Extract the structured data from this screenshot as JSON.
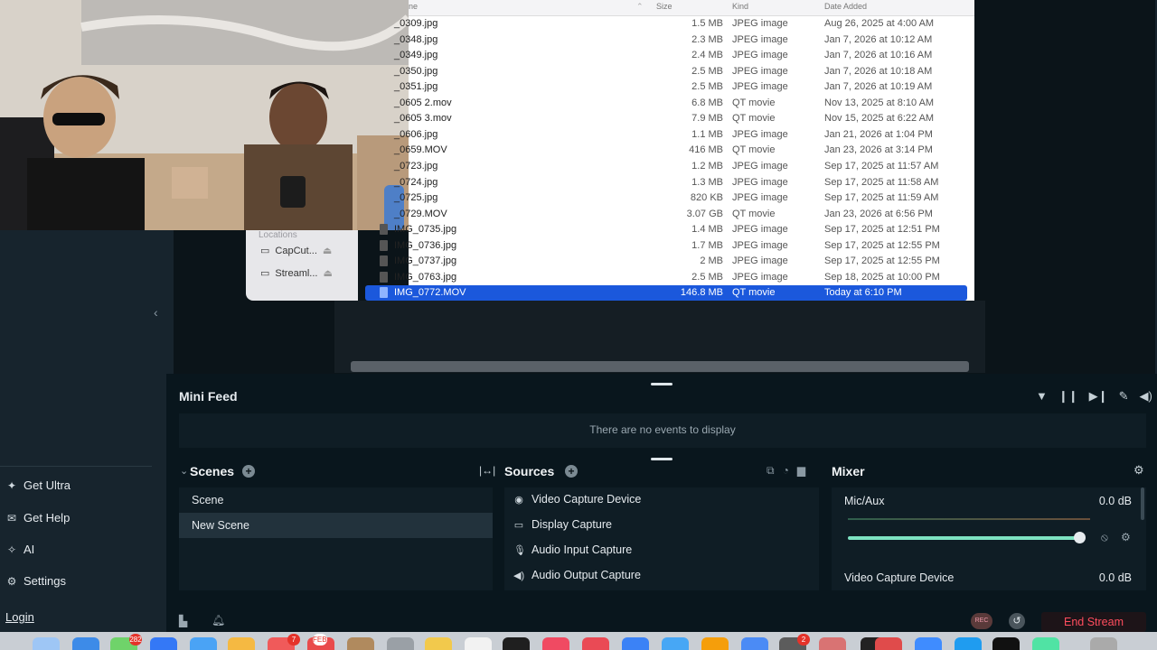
{
  "finder": {
    "columns": {
      "name": "ne",
      "size": "Size",
      "kind": "Kind",
      "date": "Date Added"
    },
    "sidebar": {
      "section": "Locations",
      "items": [
        {
          "label": "CapCut..."
        },
        {
          "label": "Streaml..."
        }
      ]
    },
    "files": [
      {
        "name": "_0309.jpg",
        "size": "1.5 MB",
        "kind": "JPEG image",
        "date": "Aug 26, 2025 at 4:00 AM"
      },
      {
        "name": "_0348.jpg",
        "size": "2.3 MB",
        "kind": "JPEG image",
        "date": "Jan 7, 2026 at 10:12 AM"
      },
      {
        "name": "_0349.jpg",
        "size": "2.4 MB",
        "kind": "JPEG image",
        "date": "Jan 7, 2026 at 10:16 AM"
      },
      {
        "name": "_0350.jpg",
        "size": "2.5 MB",
        "kind": "JPEG image",
        "date": "Jan 7, 2026 at 10:18 AM"
      },
      {
        "name": "_0351.jpg",
        "size": "2.5 MB",
        "kind": "JPEG image",
        "date": "Jan 7, 2026 at 10:19 AM"
      },
      {
        "name": "_0605 2.mov",
        "size": "6.8 MB",
        "kind": "QT movie",
        "date": "Nov 13, 2025 at 8:10 AM"
      },
      {
        "name": "_0605 3.mov",
        "size": "7.9 MB",
        "kind": "QT movie",
        "date": "Nov 15, 2025 at 6:22 AM"
      },
      {
        "name": "_0606.jpg",
        "size": "1.1 MB",
        "kind": "JPEG image",
        "date": "Jan 21, 2026 at 1:04 PM"
      },
      {
        "name": "_0659.MOV",
        "size": "416 MB",
        "kind": "QT movie",
        "date": "Jan 23, 2026 at 3:14 PM"
      },
      {
        "name": "_0723.jpg",
        "size": "1.2 MB",
        "kind": "JPEG image",
        "date": "Sep 17, 2025 at 11:57 AM"
      },
      {
        "name": "_0724.jpg",
        "size": "1.3 MB",
        "kind": "JPEG image",
        "date": "Sep 17, 2025 at 11:58 AM"
      },
      {
        "name": "_0725.jpg",
        "size": "820 KB",
        "kind": "JPEG image",
        "date": "Sep 17, 2025 at 11:59 AM"
      },
      {
        "name": "_0729.MOV",
        "size": "3.07 GB",
        "kind": "QT movie",
        "date": "Jan 23, 2026 at 6:56 PM"
      },
      {
        "name": "IMG_0735.jpg",
        "size": "1.4 MB",
        "kind": "JPEG image",
        "date": "Sep 17, 2025 at 12:51 PM"
      },
      {
        "name": "IMG_0736.jpg",
        "size": "1.7 MB",
        "kind": "JPEG image",
        "date": "Sep 17, 2025 at 12:55 PM"
      },
      {
        "name": "IMG_0737.jpg",
        "size": "2 MB",
        "kind": "JPEG image",
        "date": "Sep 17, 2025 at 12:55 PM"
      },
      {
        "name": "IMG_0763.jpg",
        "size": "2.5 MB",
        "kind": "JPEG image",
        "date": "Sep 18, 2025 at 10:00 PM"
      },
      {
        "name": "IMG_0772.MOV",
        "size": "146.8 MB",
        "kind": "QT movie",
        "date": "Today at 6:10 PM",
        "selected": true
      }
    ]
  },
  "sidebar": {
    "items": [
      {
        "label": "Get Ultra",
        "icon": "ultra-icon"
      },
      {
        "label": "Get Help",
        "icon": "help-icon"
      },
      {
        "label": "AI",
        "icon": "ai-sparkle-icon"
      },
      {
        "label": "Settings",
        "icon": "gear-icon"
      }
    ],
    "login": "Login"
  },
  "mini_feed": {
    "title": "Mini Feed",
    "empty_text": "There are no events to display"
  },
  "scenes": {
    "title": "Scenes",
    "items": [
      {
        "label": "Scene"
      },
      {
        "label": "New Scene",
        "active": true
      }
    ]
  },
  "sources": {
    "title": "Sources",
    "items": [
      {
        "label": "Video Capture Device",
        "icon": "webcam-icon"
      },
      {
        "label": "Display Capture",
        "icon": "monitor-icon"
      },
      {
        "label": "Audio Input Capture",
        "icon": "microphone-icon"
      },
      {
        "label": "Audio Output Capture",
        "icon": "speaker-icon"
      }
    ]
  },
  "mixer": {
    "title": "Mixer",
    "channels": [
      {
        "name": "Mic/Aux",
        "level": "0.0 dB",
        "volume": 1.0
      },
      {
        "name": "Video Capture Device",
        "level": "0.0 dB"
      }
    ]
  },
  "footer": {
    "rec_label": "REC",
    "end_stream": "End Stream"
  },
  "dock": {
    "badges": [
      "282",
      "7",
      "FEB",
      "2"
    ]
  },
  "colors": {
    "accent": "#7ee3c2",
    "end_stream": "#ff4d5e",
    "selection": "#1b58dc"
  }
}
